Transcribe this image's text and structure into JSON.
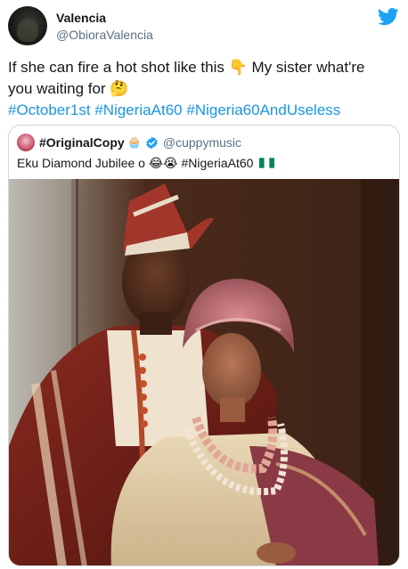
{
  "author": {
    "name": "Valencia",
    "handle": "@ObioraValencia",
    "avatar_icon": "profile-avatar"
  },
  "platform_icon": "twitter-bird-icon",
  "accent_color": "#1b95e0",
  "tweet": {
    "text_line1": "If she can fire a hot shot like this ",
    "emoji1": "👇",
    "text_line1b": " My sister what're",
    "text_line2": "you waiting for ",
    "emoji2": "🤔",
    "hashtags": [
      "#October1st",
      "#NigeriaAt60",
      "#Nigeria60AndUseless"
    ]
  },
  "quoted_tweet": {
    "name": "#OriginalCopy",
    "name_emoji": "🧁",
    "verified_icon": "verified-badge-icon",
    "handle": "@cuppymusic",
    "text": "Eku Diamond Jubilee o ",
    "emojis": "😂😭",
    "hashtag": "#NigeriaAt60",
    "flag_icon": "nigeria-flag-icon",
    "photo_alt": "photo"
  }
}
